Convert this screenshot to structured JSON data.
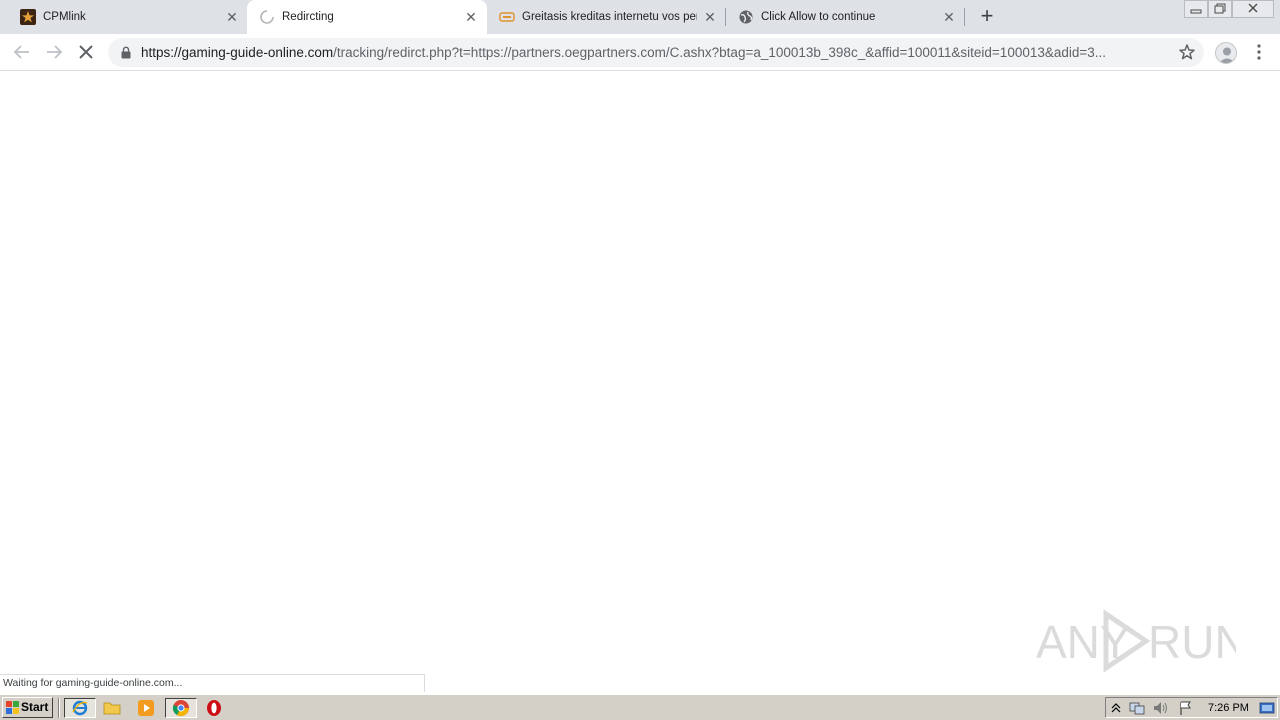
{
  "tabs": [
    {
      "title": "CPMlink",
      "icon": "star-brand-icon",
      "active": false
    },
    {
      "title": "Redircting",
      "icon": "loading-spinner-icon",
      "active": true
    },
    {
      "title": "Greitasis kreditas internetu vos per",
      "icon": "credit-card-icon",
      "active": false
    },
    {
      "title": "Click Allow to continue",
      "icon": "globe-icon",
      "active": false
    }
  ],
  "address_bar": {
    "host": "https://gaming-guide-online.com",
    "path": "/tracking/redirct.php?t=https://partners.oegpartners.com/C.ashx?btag=a_100013b_398c_&affid=100011&siteid=100013&adid=3..."
  },
  "status_bar": {
    "text": "Waiting for gaming-guide-online.com..."
  },
  "taskbar": {
    "start_label": "Start",
    "clock": "7:26 PM"
  },
  "watermark": {
    "text": "ANY RUN"
  },
  "colors": {
    "tabstrip": "#dee1e6",
    "omnibox": "#f1f3f4",
    "taskbar": "#d4d0c8"
  }
}
